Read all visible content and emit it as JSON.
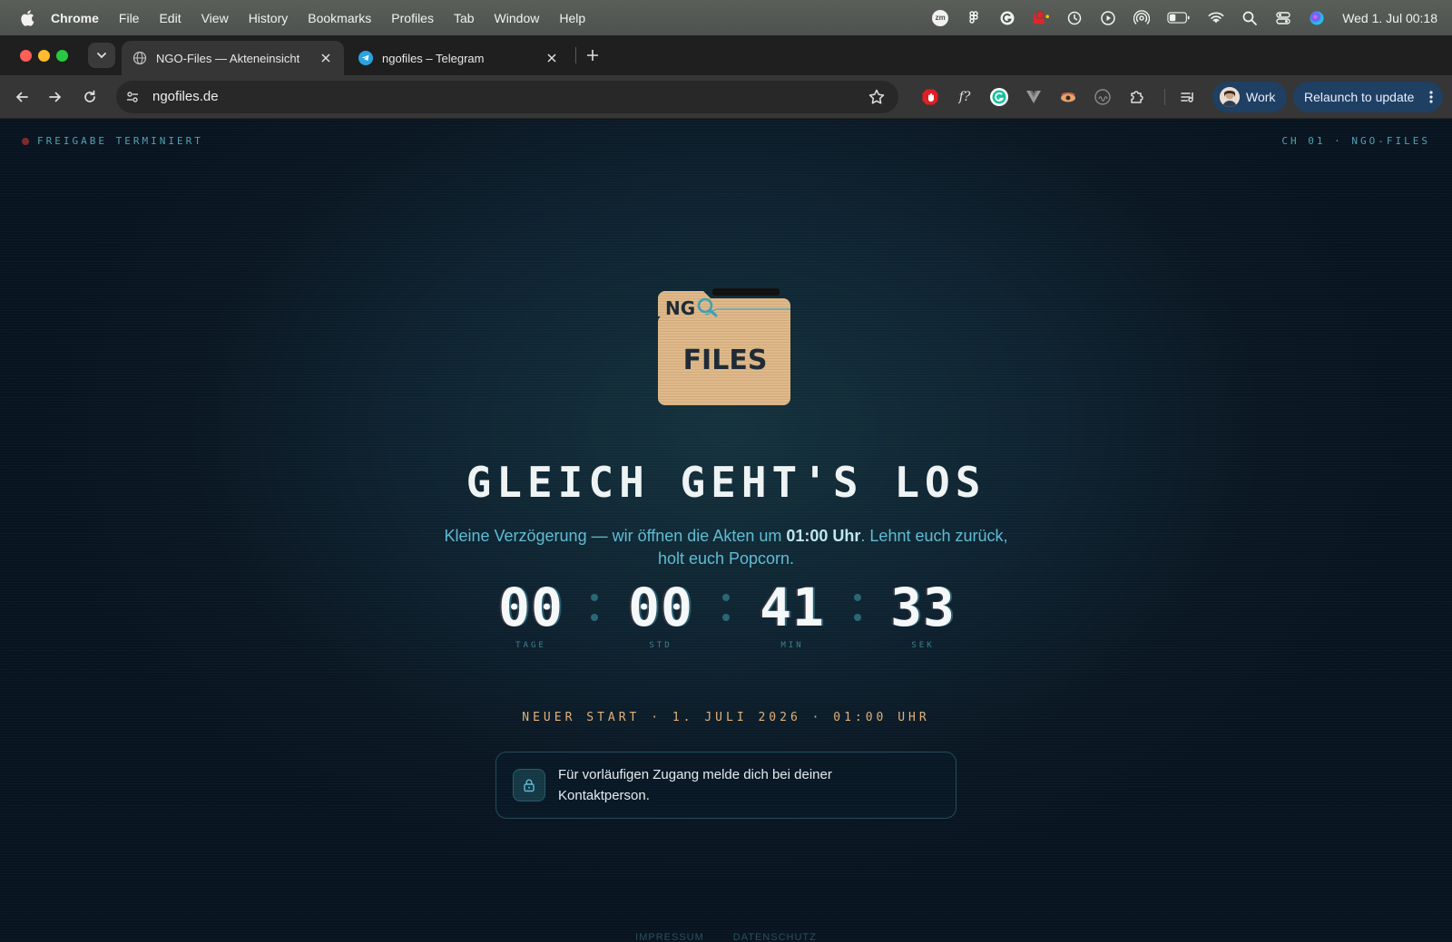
{
  "menubar": {
    "app_name": "Chrome",
    "menus": [
      "File",
      "Edit",
      "View",
      "History",
      "Bookmarks",
      "Profiles",
      "Tab",
      "Window",
      "Help"
    ],
    "clock": "Wed 1. Jul  00:18",
    "status_icons": [
      "zoom-icon",
      "figma-icon",
      "grammarly-icon",
      "adobe-icon",
      "time-machine-icon",
      "play-icon",
      "airdrop-icon",
      "battery-icon",
      "wifi-icon",
      "spotlight-icon",
      "control-center-icon",
      "siri-icon"
    ],
    "zoom_label": "zm"
  },
  "browser": {
    "tabs": [
      {
        "title": "NGO-Files — Akteneinsicht",
        "active": true,
        "favicon": "globe-icon"
      },
      {
        "title": "ngofiles – Telegram",
        "active": false,
        "favicon": "telegram-icon"
      }
    ],
    "url": "ngofiles.de",
    "profile_label": "Work",
    "relaunch_label": "Relaunch to update",
    "extension_icons": [
      "adblock-icon",
      "formula-icon",
      "grammarly-icon",
      "vuejs-icon",
      "eye-icon",
      "mymind-icon",
      "puzzle-icon",
      "reading-list-icon"
    ],
    "formula_label": "f?"
  },
  "page": {
    "status_left": "FREIGABE TERMINIERT",
    "status_right": "CH 01 · NGO-FILES",
    "logo": {
      "top_text": "NG",
      "main_text": "FILES"
    },
    "headline": "GLEICH GEHT'S LOS",
    "subline_before": "Kleine Verzögerung — wir öffnen die Akten um ",
    "subline_time": "01:00 Uhr",
    "subline_after": ". Lehnt euch zurück, holt euch Popcorn.",
    "countdown": [
      {
        "value": "00",
        "label": "TAGE"
      },
      {
        "value": "00",
        "label": "STD"
      },
      {
        "value": "41",
        "label": "MIN"
      },
      {
        "value": "33",
        "label": "SEK"
      }
    ],
    "restart_text": "NEUER START · 1. JULI 2026 · 01:00 UHR",
    "info_text": "Für vorläufigen Zugang melde dich bei deiner Kontaktperson.",
    "footer_links": [
      "IMPRESSUM",
      "DATENSCHUTZ"
    ]
  },
  "colors": {
    "accent": "#5fbcd2",
    "restart": "#e1b07a",
    "chrome_blue": "#1f3f63",
    "folder": "#dfb98a"
  }
}
